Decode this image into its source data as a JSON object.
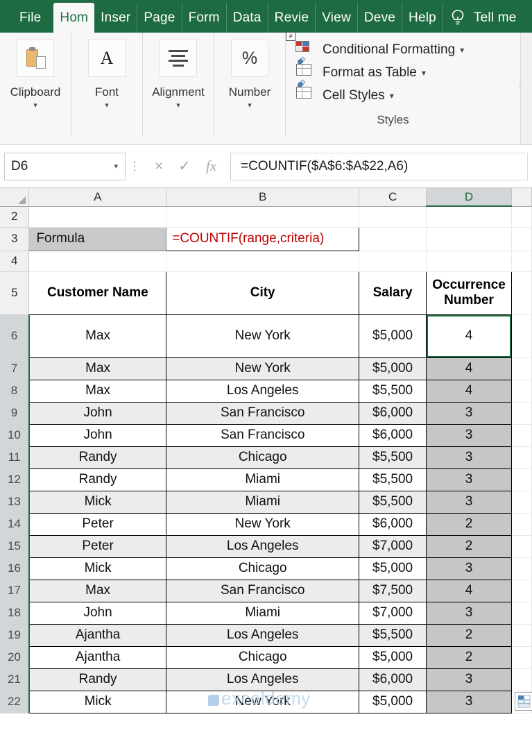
{
  "ribbon": {
    "tabs": [
      {
        "label": "File",
        "active": false
      },
      {
        "label": "Hom",
        "active": true
      },
      {
        "label": "Inser",
        "active": false
      },
      {
        "label": "Page",
        "active": false
      },
      {
        "label": "Form",
        "active": false
      },
      {
        "label": "Data",
        "active": false
      },
      {
        "label": "Revie",
        "active": false
      },
      {
        "label": "View",
        "active": false
      },
      {
        "label": "Deve",
        "active": false
      },
      {
        "label": "Help",
        "active": false
      }
    ],
    "tell_me": "Tell me",
    "groups": [
      {
        "label": "Clipboard",
        "icon": "clipboard-icon"
      },
      {
        "label": "Font",
        "icon": "font-icon"
      },
      {
        "label": "Alignment",
        "icon": "alignment-icon"
      },
      {
        "label": "Number",
        "icon": "percent-icon"
      }
    ],
    "styles": {
      "caption": "Styles",
      "items": [
        {
          "label": "Conditional Formatting",
          "icon": "conditional-formatting-icon"
        },
        {
          "label": "Format as Table",
          "icon": "format-as-table-icon"
        },
        {
          "label": "Cell Styles",
          "icon": "cell-styles-icon"
        }
      ]
    }
  },
  "formula_bar": {
    "name_box": "D6",
    "cancel": "×",
    "enter": "✓",
    "fx": "fx",
    "formula": "=COUNTIF($A$6:$A$22,A6)"
  },
  "grid": {
    "columns": [
      "A",
      "B",
      "C",
      "D"
    ],
    "selected_column": "D",
    "row_numbers": [
      "2",
      "3",
      "4",
      "5",
      "6",
      "7",
      "8",
      "9",
      "10",
      "11",
      "12",
      "13",
      "14",
      "15",
      "16",
      "17",
      "18",
      "19",
      "20",
      "21",
      "22"
    ],
    "formula_row": {
      "label": "Formula",
      "value": "=COUNTIF(range,criteria)",
      "value_color": "#c00000"
    },
    "headers": [
      "Customer Name",
      "City",
      "Salary",
      "Occurrence Number"
    ],
    "rows": [
      {
        "row": "6",
        "name": "Max",
        "city": "New York",
        "salary": "$5,000",
        "occurrence": "4"
      },
      {
        "row": "7",
        "name": "Max",
        "city": "New York",
        "salary": "$5,000",
        "occurrence": "4"
      },
      {
        "row": "8",
        "name": "Max",
        "city": "Los Angeles",
        "salary": "$5,500",
        "occurrence": "4"
      },
      {
        "row": "9",
        "name": "John",
        "city": "San Francisco",
        "salary": "$6,000",
        "occurrence": "3"
      },
      {
        "row": "10",
        "name": "John",
        "city": "San Francisco",
        "salary": "$6,000",
        "occurrence": "3"
      },
      {
        "row": "11",
        "name": "Randy",
        "city": "Chicago",
        "salary": "$5,500",
        "occurrence": "3"
      },
      {
        "row": "12",
        "name": "Randy",
        "city": "Miami",
        "salary": "$5,500",
        "occurrence": "3"
      },
      {
        "row": "13",
        "name": "Mick",
        "city": "Miami",
        "salary": "$5,500",
        "occurrence": "3"
      },
      {
        "row": "14",
        "name": "Peter",
        "city": "New York",
        "salary": "$6,000",
        "occurrence": "2"
      },
      {
        "row": "15",
        "name": "Peter",
        "city": "Los Angeles",
        "salary": "$7,000",
        "occurrence": "2"
      },
      {
        "row": "16",
        "name": "Mick",
        "city": "Chicago",
        "salary": "$5,000",
        "occurrence": "3"
      },
      {
        "row": "17",
        "name": "Max",
        "city": "San Francisco",
        "salary": "$7,500",
        "occurrence": "4"
      },
      {
        "row": "18",
        "name": "John",
        "city": "Miami",
        "salary": "$7,000",
        "occurrence": "3"
      },
      {
        "row": "19",
        "name": "Ajantha",
        "city": "Los Angeles",
        "salary": "$5,500",
        "occurrence": "2"
      },
      {
        "row": "20",
        "name": "Ajantha",
        "city": "Chicago",
        "salary": "$5,000",
        "occurrence": "2"
      },
      {
        "row": "21",
        "name": "Randy",
        "city": "Los Angeles",
        "salary": "$6,000",
        "occurrence": "3"
      },
      {
        "row": "22",
        "name": "Mick",
        "city": "New York",
        "salary": "$5,000",
        "occurrence": "3"
      }
    ],
    "active_cell": "D6",
    "selection_range": "D6:D22"
  },
  "watermark": {
    "text": "exceldemy",
    "sub": "..."
  },
  "colors": {
    "ribbon_green": "#1e6b41",
    "selection_green": "#1e6b41",
    "formula_red": "#c00000",
    "selected_fill": "#c6c6c6",
    "header_gray": "#f0f0f0"
  }
}
